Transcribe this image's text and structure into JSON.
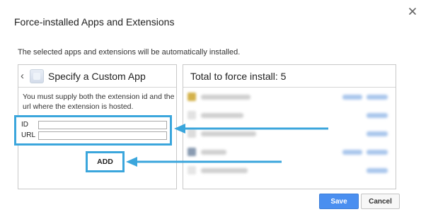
{
  "dialog": {
    "title": "Force-installed Apps and Extensions",
    "subtitle": "The selected apps and extensions will be automatically installed.",
    "close_icon": "close-icon"
  },
  "left_panel": {
    "back_icon": "chevron-left-icon",
    "app_icon": "custom-app-icon",
    "title": "Specify a Custom App",
    "instructions": "You must supply both the extension id and the url where the extension is hosted.",
    "fields": {
      "id_label": "ID",
      "id_value": "",
      "url_label": "URL",
      "url_value": ""
    },
    "add_label": "ADD"
  },
  "right_panel": {
    "title": "Total to force install: 5"
  },
  "footer": {
    "save_label": "Save",
    "cancel_label": "Cancel"
  },
  "colors": {
    "highlight": "#3ba6dc",
    "primary_button": "#4a8ff0"
  }
}
